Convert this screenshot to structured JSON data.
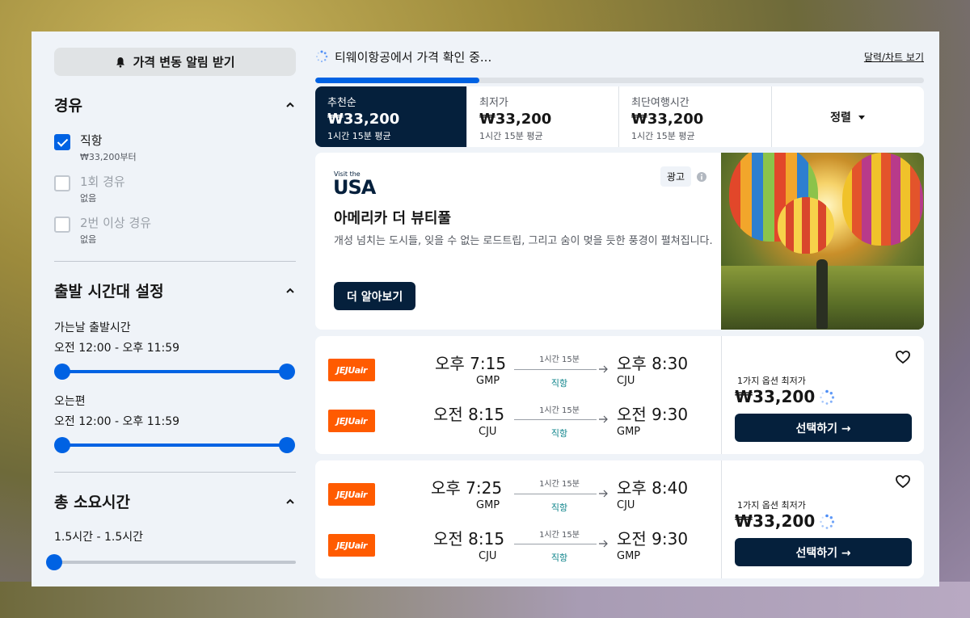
{
  "sidebar": {
    "alert_button": "가격 변동 알림 받기",
    "stops": {
      "title": "경유",
      "options": [
        {
          "label": "직항",
          "sub": "₩33,200부터",
          "checked": true
        },
        {
          "label": "1회 경유",
          "sub": "없음",
          "checked": false
        },
        {
          "label": "2번 이상 경유",
          "sub": "없음",
          "checked": false
        }
      ]
    },
    "departure": {
      "title": "출발 시간대 설정",
      "outbound_label": "가는날 출발시간",
      "outbound_value": "오전 12:00 - 오후 11:59",
      "return_label": "오는편",
      "return_value": "오전 12:00 - 오후 11:59"
    },
    "duration": {
      "title": "총 소요시간",
      "value": "1.5시간 - 1.5시간"
    }
  },
  "main": {
    "status": "티웨이항공에서 가격 확인 중...",
    "chart_link": "달력/차트 보기",
    "progress_fraction": 0.27,
    "tabs": [
      {
        "name": "추천순",
        "price": "₩33,200",
        "sub": "1시간 15분 평균"
      },
      {
        "name": "최저가",
        "price": "₩33,200",
        "sub": "1시간 15분 평균"
      },
      {
        "name": "최단여행시간",
        "price": "₩33,200",
        "sub": "1시간 15분 평균"
      }
    ],
    "sort_label": "정렬",
    "ad": {
      "logo_top": "Visit the",
      "logo": "USA",
      "tag": "광고",
      "title": "아메리카 더 뷰티풀",
      "description": "개성 넘치는 도시들, 잊을 수 없는 로드트립, 그리고 숨이 멎을 듯한 풍경이 펼쳐집니다.",
      "button": "더 알아보기"
    },
    "flights": [
      {
        "legs": [
          {
            "airline": "JEJUair",
            "dep_time": "오후 7:15",
            "dep_code": "GMP",
            "duration": "1시간 15분",
            "stops": "직항",
            "arr_time": "오후 8:30",
            "arr_code": "CJU"
          },
          {
            "airline": "JEJUair",
            "dep_time": "오전 8:15",
            "dep_code": "CJU",
            "duration": "1시간 15분",
            "stops": "직항",
            "arr_time": "오전 9:30",
            "arr_code": "GMP"
          }
        ],
        "option_label": "1가지 옵션 최저가",
        "price": "₩33,200",
        "select": "선택하기 →"
      },
      {
        "legs": [
          {
            "airline": "JEJUair",
            "dep_time": "오후 7:25",
            "dep_code": "GMP",
            "duration": "1시간 15분",
            "stops": "직항",
            "arr_time": "오후 8:40",
            "arr_code": "CJU"
          },
          {
            "airline": "JEJUair",
            "dep_time": "오전 8:15",
            "dep_code": "CJU",
            "duration": "1시간 15분",
            "stops": "직항",
            "arr_time": "오전 9:30",
            "arr_code": "GMP"
          }
        ],
        "option_label": "1가지 옵션 최저가",
        "price": "₩33,200",
        "select": "선택하기 →"
      }
    ]
  },
  "colors": {
    "accent": "#0062e3",
    "navy": "#05203c",
    "airline": "#ff5b00",
    "direct": "#0c838a"
  }
}
